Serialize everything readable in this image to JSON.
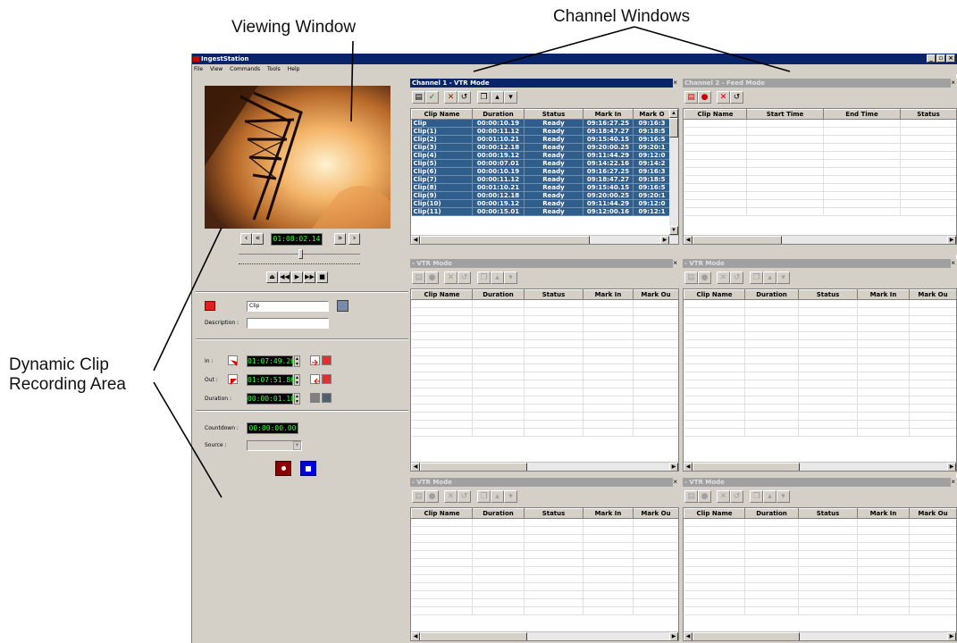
{
  "callouts": {
    "viewing_window": "Viewing Window",
    "channel_windows": "Channel Windows",
    "dynamic_clip_line1": "Dynamic Clip",
    "dynamic_clip_line2": "Recording Area"
  },
  "app": {
    "title": "IngestStation",
    "menu": [
      "File",
      "View",
      "Commands",
      "Tools",
      "Help"
    ]
  },
  "left": {
    "player_timecode": "01:08:02.14",
    "clip_name": "Clip",
    "description_label": "Description :",
    "description_value": "",
    "in_label": "In :",
    "in_tc": "01:07:49.26",
    "out_label": "Out :",
    "out_tc": "01:07:51.86",
    "duration_label": "Duration :",
    "duration_tc": "00:00:01.10",
    "countdown_label": "Countdown :",
    "countdown_tc": "00:00:00.00",
    "source_label": "Source :",
    "source_value": ""
  },
  "channels": {
    "ch1": {
      "title": "Channel 1 - VTR Mode",
      "columns": [
        "Clip Name",
        "Duration",
        "Status",
        "Mark In",
        "Mark O"
      ],
      "rows": [
        [
          "Clip",
          "00:00:10.19",
          "Ready",
          "09:16:27.25",
          "09:16:3"
        ],
        [
          "Clip(1)",
          "00:00:11.12",
          "Ready",
          "09:18:47.27",
          "09:18:5"
        ],
        [
          "Clip(2)",
          "00:01:10.21",
          "Ready",
          "09:15:40.15",
          "09:16:5"
        ],
        [
          "Clip(3)",
          "00:00:12.18",
          "Ready",
          "09:20:00.25",
          "09:20:1"
        ],
        [
          "Clip(4)",
          "00:00:19.12",
          "Ready",
          "09:11:44.29",
          "09:12:0"
        ],
        [
          "Clip(5)",
          "00:00:07.01",
          "Ready",
          "09:14:22.16",
          "09:14:2"
        ],
        [
          "Clip(6)",
          "00:00:10.19",
          "Ready",
          "09:16:27.25",
          "09:16:3"
        ],
        [
          "Clip(7)",
          "00:00:11.12",
          "Ready",
          "09:18:47.27",
          "09:18:5"
        ],
        [
          "Clip(8)",
          "00:01:10.21",
          "Ready",
          "09:15:40.15",
          "09:16:5"
        ],
        [
          "Clip(9)",
          "00:00:12.18",
          "Ready",
          "09:20:00.25",
          "09:20:1"
        ],
        [
          "Clip(10)",
          "00:00:19.12",
          "Ready",
          "09:11:44.29",
          "09:12:0"
        ],
        [
          "Clip(11)",
          "00:00:15.01",
          "Ready",
          "09:12:00.16",
          "09:12:1"
        ]
      ]
    },
    "ch2": {
      "title": "Channel 2 - Feed Mode",
      "columns": [
        "Clip Name",
        "Start Time",
        "End Time",
        "Status"
      ]
    },
    "ch3": {
      "title": "- VTR Mode",
      "columns": [
        "Clip Name",
        "Duration",
        "Status",
        "Mark In",
        "Mark Ou"
      ]
    },
    "ch4": {
      "title": "- VTR Mode",
      "columns": [
        "Clip Name",
        "Duration",
        "Status",
        "Mark In",
        "Mark Ou"
      ]
    },
    "ch5": {
      "title": "- VTR Mode",
      "columns": [
        "Clip Name",
        "Duration",
        "Status",
        "Mark In",
        "Mark Ou"
      ]
    },
    "ch6": {
      "title": "- VTR Mode",
      "columns": [
        "Clip Name",
        "Duration",
        "Status",
        "Mark In",
        "Mark Ou"
      ]
    }
  }
}
